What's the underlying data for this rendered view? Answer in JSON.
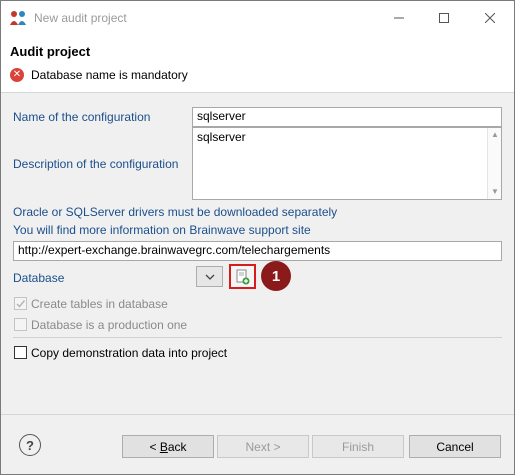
{
  "window": {
    "title": "New audit project"
  },
  "header": {
    "title": "Audit project",
    "error_message": "Database name is mandatory"
  },
  "form": {
    "config_name_label": "Name of the configuration",
    "config_name_value": "sqlserver",
    "description_label": "Description of the configuration",
    "description_value": "sqlserver",
    "drivers_notice": "Oracle or SQLServer drivers must be downloaded separately",
    "support_notice": "You will find more information on Brainwave support site",
    "support_url": "http://expert-exchange.brainwavegrc.com/telechargements",
    "database_label": "Database",
    "callout_number": "1",
    "create_tables_label": "Create tables in database",
    "create_tables_checked": true,
    "production_label": "Database is a production one",
    "production_checked": false,
    "demo_data_label": "Copy demonstration data into project",
    "demo_data_checked": false
  },
  "buttons": {
    "back_prefix": "< ",
    "back_mnemonic": "B",
    "back_rest": "ack",
    "next": "Next >",
    "finish": "Finish",
    "cancel": "Cancel",
    "help": "?"
  },
  "colors": {
    "callout": "#8b1a1a",
    "highlight_border": "#d51d1d",
    "error": "#d9433a",
    "link_label": "#1b4f8c"
  }
}
